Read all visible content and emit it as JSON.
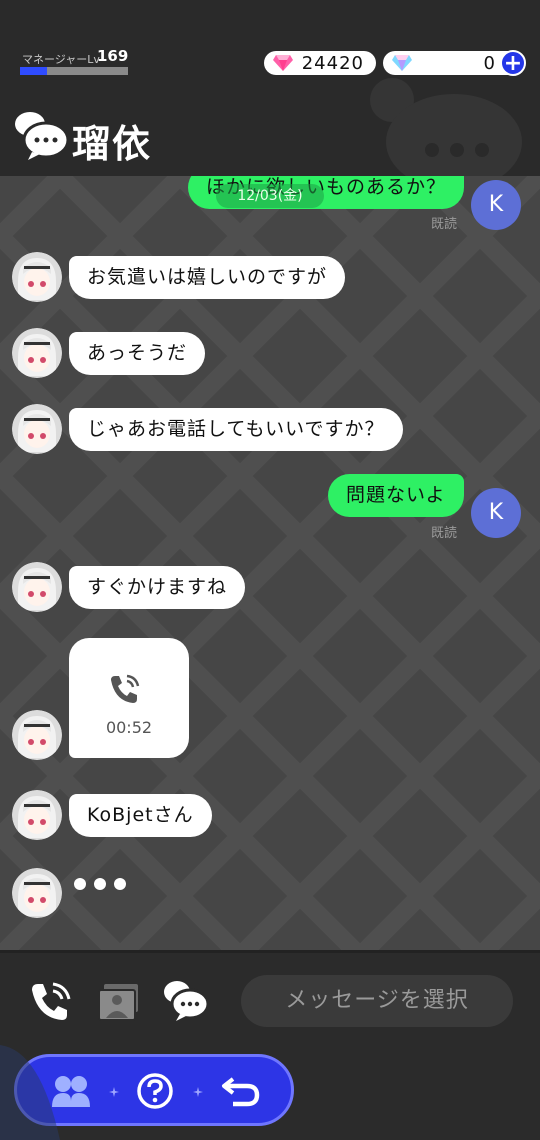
{
  "header": {
    "level_label": "マネージャーLv",
    "level_value": "169",
    "level_progress": 0.25,
    "gems_red": "24420",
    "gems_blue": "0",
    "plus_label": "+",
    "title": "瑠依"
  },
  "chat": {
    "date": "12/03(金)",
    "user_initial": "K",
    "read_label": "既読",
    "messages": [
      {
        "side": "sent",
        "text": "ほかに欲しいものあるか？"
      },
      {
        "side": "recv",
        "text": "お気遣いは嬉しいのですが"
      },
      {
        "side": "recv",
        "text": "あっそうだ"
      },
      {
        "side": "recv",
        "text": "じゃあお電話してもいいですか？"
      },
      {
        "side": "sent",
        "text": "問題ないよ"
      },
      {
        "side": "recv",
        "text": "すぐかけますね"
      },
      {
        "side": "recv",
        "text": "KoBjetさん"
      }
    ],
    "call_duration": "00:52"
  },
  "footer": {
    "message_select_placeholder": "メッセージを選択"
  },
  "icons": {
    "phone": "phone-icon",
    "gallery": "gallery-icon",
    "chat": "chat-bubbles-icon",
    "members": "members-icon",
    "help": "help-icon",
    "back": "back-arrow-icon"
  },
  "colors": {
    "sent_bubble": "#2ef064",
    "received_bubble": "#ffffff",
    "accent": "#2d35e6",
    "user_avatar": "#5d6fd6"
  }
}
